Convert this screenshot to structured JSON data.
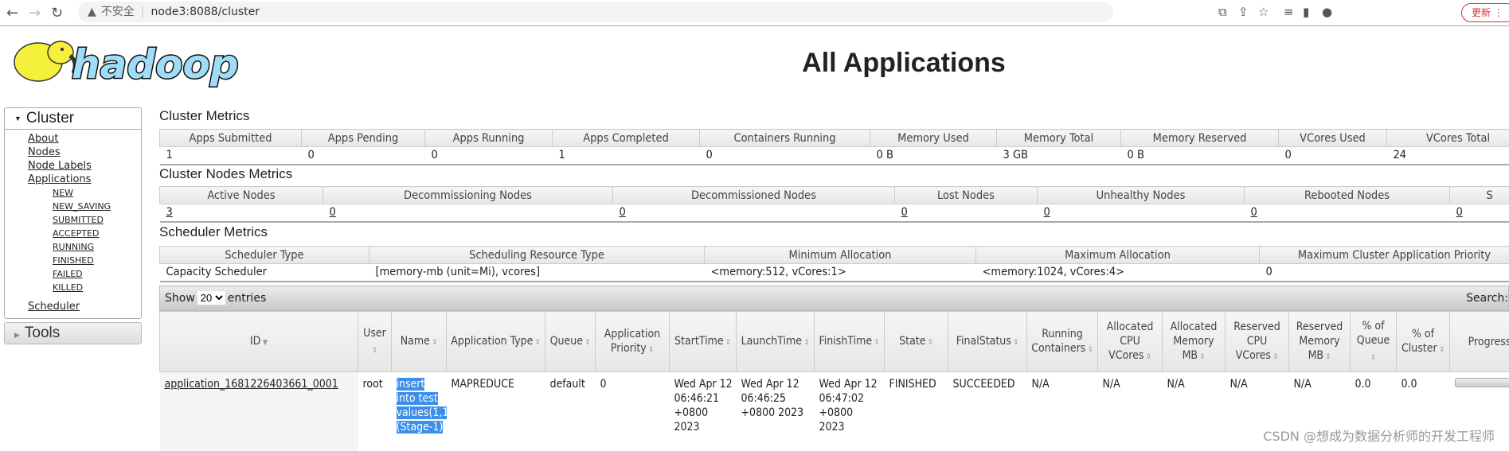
{
  "browser": {
    "url_host": "node3:8088/cluster",
    "security_label": "不安全",
    "update_label": "更新"
  },
  "page_title": "All Applications",
  "sidebar": {
    "cluster_label": "Cluster",
    "tools_label": "Tools",
    "links": [
      "About",
      "Nodes",
      "Node Labels",
      "Applications"
    ],
    "app_states": [
      "NEW",
      "NEW_SAVING",
      "SUBMITTED",
      "ACCEPTED",
      "RUNNING",
      "FINISHED",
      "FAILED",
      "KILLED"
    ],
    "scheduler": "Scheduler"
  },
  "cluster_metrics": {
    "title": "Cluster Metrics",
    "headers": [
      "Apps Submitted",
      "Apps Pending",
      "Apps Running",
      "Apps Completed",
      "Containers Running",
      "Memory Used",
      "Memory Total",
      "Memory Reserved",
      "VCores Used",
      "VCores Total"
    ],
    "values": [
      "1",
      "0",
      "0",
      "1",
      "0",
      "0 B",
      "3 GB",
      "0 B",
      "0",
      "24"
    ]
  },
  "nodes_metrics": {
    "title": "Cluster Nodes Metrics",
    "headers": [
      "Active Nodes",
      "Decommissioning Nodes",
      "Decommissioned Nodes",
      "Lost Nodes",
      "Unhealthy Nodes",
      "Rebooted Nodes",
      "S"
    ],
    "values": [
      "3",
      "0",
      "0",
      "0",
      "0",
      "0",
      "0"
    ]
  },
  "scheduler_metrics": {
    "title": "Scheduler Metrics",
    "headers": [
      "Scheduler Type",
      "Scheduling Resource Type",
      "Minimum Allocation",
      "Maximum Allocation",
      "Maximum Cluster Application Priority"
    ],
    "values": [
      "Capacity Scheduler",
      "[memory-mb (unit=Mi), vcores]",
      "<memory:512, vCores:1>",
      "<memory:1024, vCores:4>",
      "0"
    ]
  },
  "apps_table": {
    "show_label": "Show",
    "entries_label": "entries",
    "page_size": "20",
    "search_label": "Search:",
    "headers": [
      "ID",
      "User",
      "Name",
      "Application Type",
      "Queue",
      "Application Priority",
      "StartTime",
      "LaunchTime",
      "FinishTime",
      "State",
      "FinalStatus",
      "Running Containers",
      "Allocated CPU VCores",
      "Allocated Memory MB",
      "Reserved CPU VCores",
      "Reserved Memory MB",
      "% of Queue",
      "% of Cluster",
      "Progress"
    ],
    "rows": [
      [
        "application_1681226403661_0001",
        "root",
        "insert into test values(1,1)(Stage-1)",
        "MAPREDUCE",
        "default",
        "0",
        "Wed Apr 12 06:46:21 +0800 2023",
        "Wed Apr 12 06:46:25 +0800 2023",
        "Wed Apr 12 06:47:02 +0800 2023",
        "FINISHED",
        "SUCCEEDED",
        "N/A",
        "N/A",
        "N/A",
        "N/A",
        "N/A",
        "0.0",
        "0.0",
        ""
      ]
    ],
    "progress": [
      1.0
    ]
  },
  "watermark": "CSDN @想成为数据分析师的开发工程师"
}
